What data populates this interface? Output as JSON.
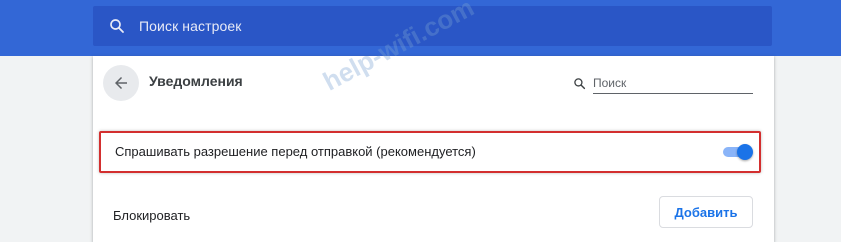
{
  "search": {
    "placeholder": "Поиск настроек"
  },
  "page": {
    "title": "Уведомления",
    "search_placeholder": "Поиск"
  },
  "setting": {
    "ask_before_sending_label": "Спрашивать разрешение перед отправкой (рекомендуется)",
    "ask_before_sending_enabled": true
  },
  "block": {
    "label": "Блокировать",
    "add_button": "Добавить"
  },
  "watermark": "help-wifi.com",
  "colors": {
    "header_blue": "#3367d6",
    "search_blue": "#2a56c6",
    "accent": "#1a73e8",
    "highlight_red": "#d32f2f"
  },
  "icons": {
    "search": "search-icon",
    "back": "arrow-back-icon",
    "filter_search": "search-icon"
  }
}
